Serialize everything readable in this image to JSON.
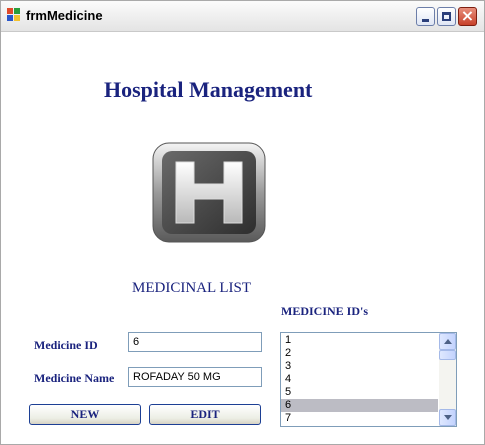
{
  "window": {
    "title": "frmMedicine"
  },
  "header": {
    "title": "Hospital Management"
  },
  "section": {
    "title": "MEDICINAL LIST",
    "ids_heading": "MEDICINE  ID's"
  },
  "form": {
    "medicine_id_label": "Medicine ID",
    "medicine_id_value": "6",
    "medicine_name_label": "Medicine Name",
    "medicine_name_value": "ROFADAY 50 MG"
  },
  "buttons": {
    "new_label": "NEW",
    "edit_label": "EDIT"
  },
  "id_list": {
    "items": [
      "1",
      "2",
      "3",
      "4",
      "5",
      "6",
      "7"
    ],
    "selected": "6"
  },
  "icons": {
    "app": "app-window-icon",
    "logo": "hospital-h-logo"
  },
  "colors": {
    "heading": "#1a237e",
    "selection": "#bcbcc4"
  }
}
